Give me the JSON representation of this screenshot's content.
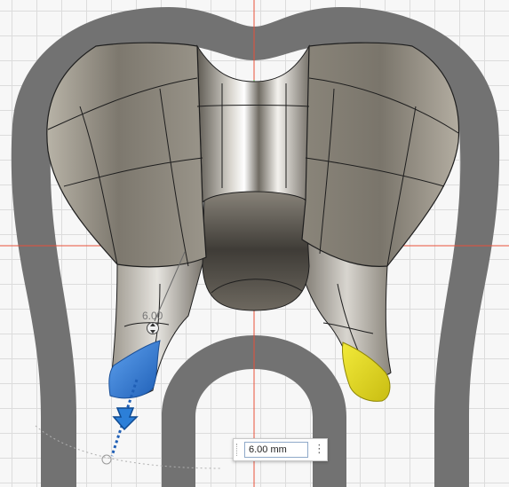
{
  "viewport": {
    "dimension_label": "6.00",
    "dimension_input_value": "6.00 mm",
    "options_icon": "more-options-icon",
    "colors": {
      "sketch_profile": "#707070",
      "axis_red": "#e8503a",
      "axis_green": "#5fb040",
      "body_metal": "#8f8a80",
      "selected_face": "#3b82d8",
      "highlighted_face": "#e6dc1e",
      "grid": "#dcdcdc"
    }
  }
}
